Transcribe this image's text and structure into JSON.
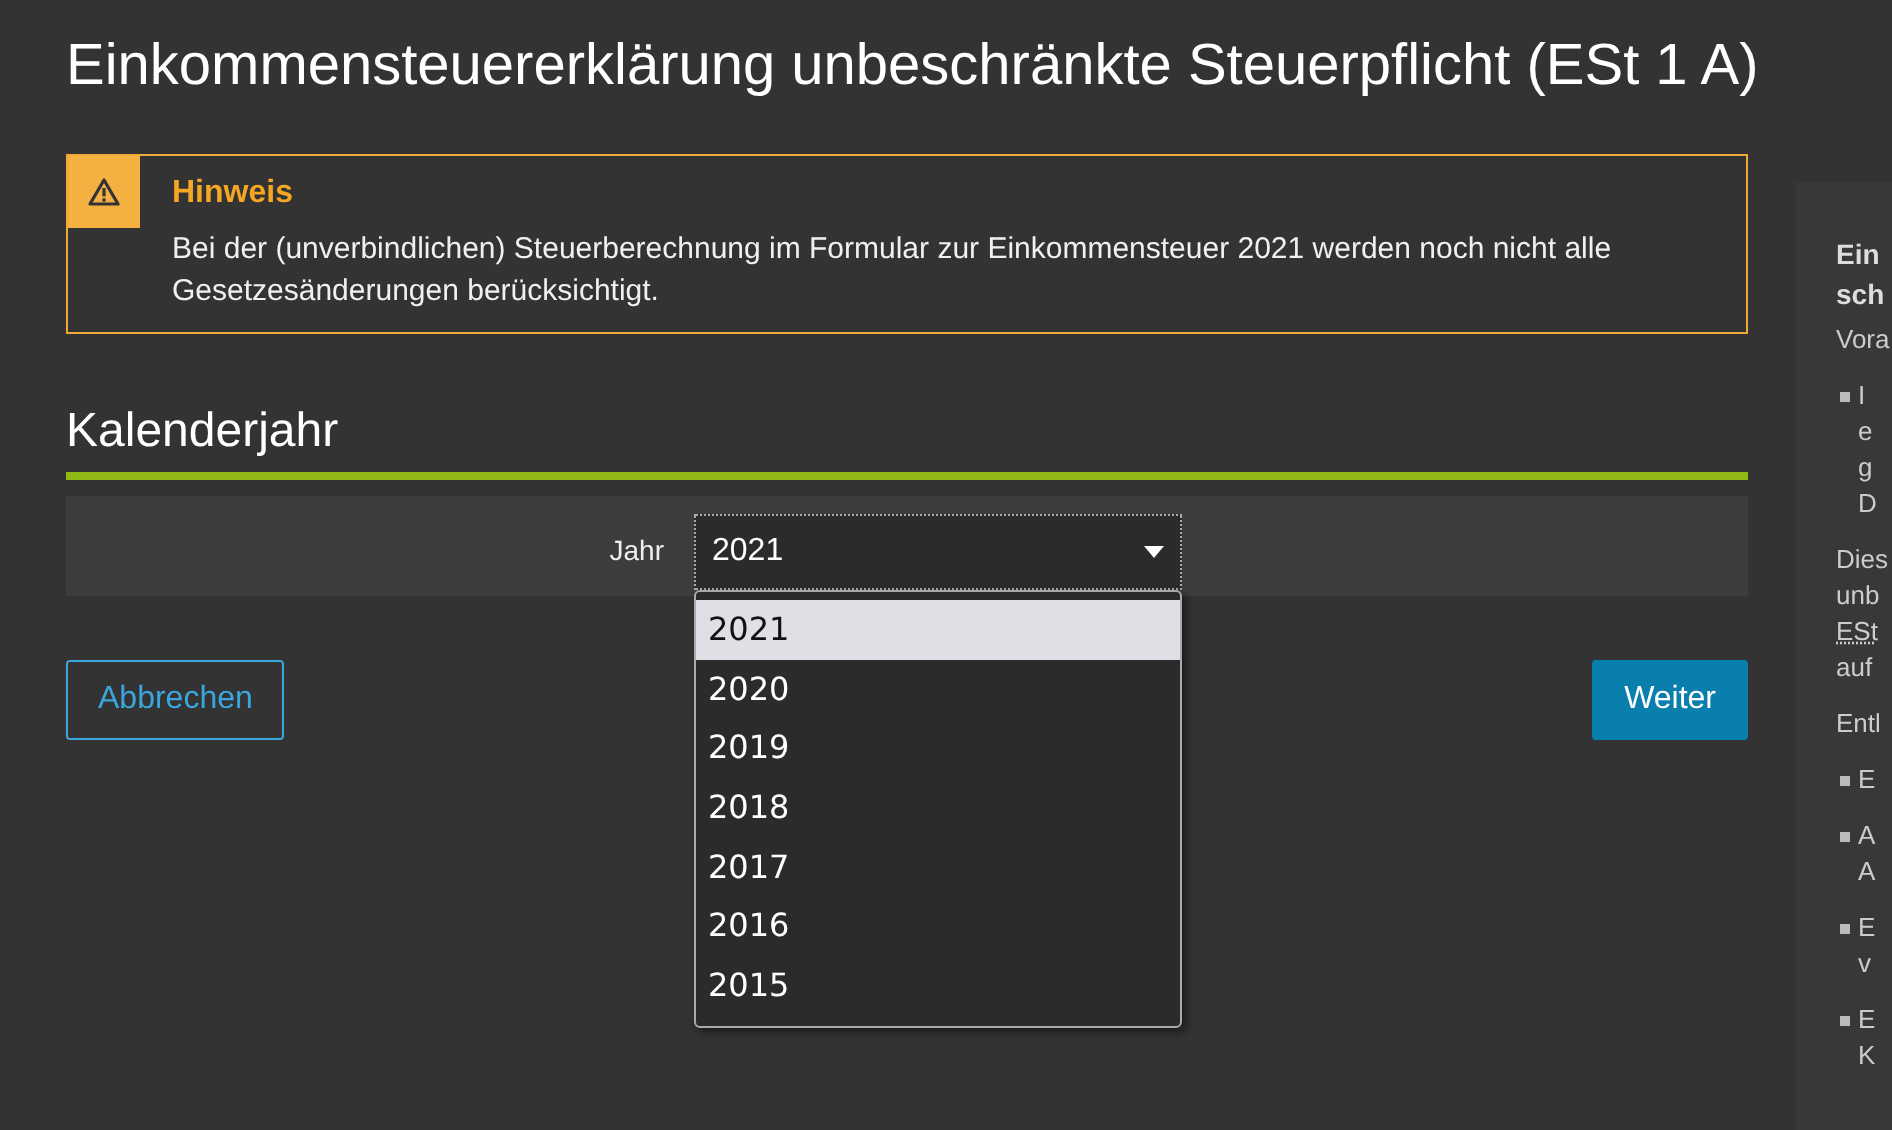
{
  "title": "Einkommensteuererklärung unbeschränkte Steuerpflicht (ESt 1 A)",
  "notice": {
    "heading": "Hinweis",
    "text": "Bei der (unverbindlichen) Steuerberechnung im Formular zur Einkommensteuer 2021 werden noch nicht alle Gesetzesänderungen berücksichtigt."
  },
  "section": {
    "heading": "Kalenderjahr"
  },
  "year_field": {
    "label": "Jahr",
    "value": "2021",
    "expanded": true,
    "options": [
      {
        "label": "2021",
        "selected": true
      },
      {
        "label": "2020",
        "selected": false
      },
      {
        "label": "2019",
        "selected": false
      },
      {
        "label": "2018",
        "selected": false
      },
      {
        "label": "2017",
        "selected": false
      },
      {
        "label": "2016",
        "selected": false
      },
      {
        "label": "2015",
        "selected": false
      }
    ]
  },
  "buttons": [
    {
      "label": "Abbrechen",
      "kind": "secondary"
    },
    {
      "label": "Weiter",
      "kind": "primary"
    }
  ],
  "sidebar": {
    "heading_lines": [
      "Ein",
      "sch"
    ],
    "blocks": [
      {
        "kind": "text",
        "lines": [
          {
            "text": "Vora",
            "link": false
          }
        ]
      },
      {
        "kind": "list",
        "items": [
          [
            "I",
            "e",
            "g",
            "D"
          ]
        ]
      },
      {
        "kind": "text",
        "lines": [
          {
            "text": "Dies",
            "link": false
          },
          {
            "text": "unb",
            "link": false
          },
          {
            "text": "ESt",
            "link": true
          },
          {
            "text": "auf",
            "link": false
          }
        ]
      },
      {
        "kind": "text",
        "lines": [
          {
            "text": "Entl",
            "link": false
          }
        ]
      },
      {
        "kind": "list",
        "items": [
          [
            "E"
          ],
          [
            "A",
            "A"
          ],
          [
            "E",
            "v"
          ],
          [
            "E",
            "K"
          ]
        ]
      }
    ]
  }
}
